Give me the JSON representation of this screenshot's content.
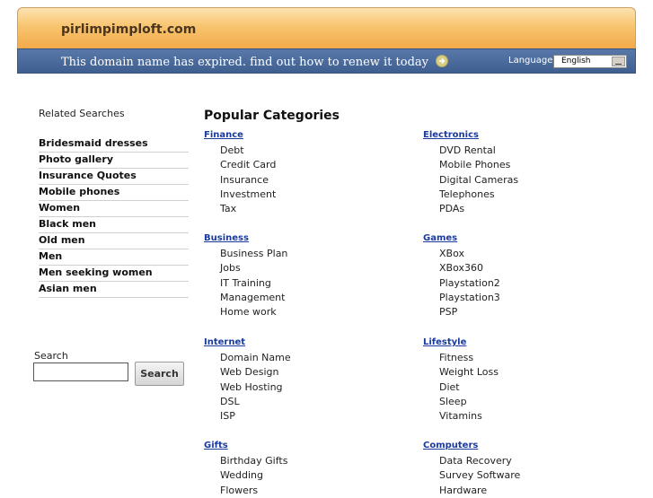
{
  "header": {
    "site_title": "pirlimpimploft.com",
    "expired_message": "This domain name has expired. find out how to renew it today",
    "language_label": "Language:",
    "language_value": "English"
  },
  "related": {
    "heading": "Related Searches",
    "items": [
      "Bridesmaid dresses",
      "Photo gallery",
      "Insurance Quotes",
      "Mobile phones",
      "Women",
      "Black men",
      "Old men",
      "Men",
      "Men seeking women",
      "Asian men"
    ]
  },
  "search": {
    "label": "Search",
    "button": "Search"
  },
  "popular": {
    "heading": "Popular Categories",
    "categories": [
      {
        "title": "Finance",
        "items": [
          "Debt",
          "Credit Card",
          "Insurance",
          "Investment",
          "Tax"
        ]
      },
      {
        "title": "Electronics",
        "items": [
          "DVD Rental",
          "Mobile Phones",
          "Digital Cameras",
          "Telephones",
          "PDAs"
        ]
      },
      {
        "title": "Business",
        "items": [
          "Business Plan",
          "Jobs",
          "IT Training",
          "Management",
          "Home work"
        ]
      },
      {
        "title": "Games",
        "items": [
          "XBox",
          "XBox360",
          "Playstation2",
          "Playstation3",
          "PSP"
        ]
      },
      {
        "title": "Internet",
        "items": [
          "Domain Name",
          "Web Design",
          "Web Hosting",
          "DSL",
          "ISP"
        ]
      },
      {
        "title": "Lifestyle",
        "items": [
          "Fitness",
          "Weight Loss",
          "Diet",
          "Sleep",
          "Vitamins"
        ]
      },
      {
        "title": "Gifts",
        "items": [
          "Birthday Gifts",
          "Wedding",
          "Flowers"
        ]
      },
      {
        "title": "Computers",
        "items": [
          "Data Recovery",
          "Survey Software",
          "Hardware"
        ]
      }
    ]
  },
  "icons": {
    "renew": "arrow-right-circle-icon",
    "lang_dropdown": "chevron-down-icon"
  }
}
